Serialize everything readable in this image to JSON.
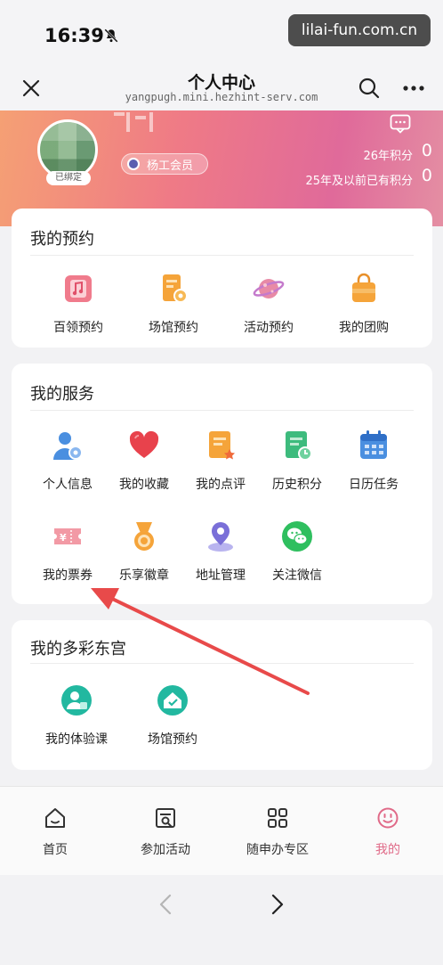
{
  "status": {
    "time": "16:39",
    "watermark": "lilai-fun.com.cn"
  },
  "nav": {
    "title": "个人中心",
    "subtitle": "yangpugh.mini.hezhint-serv.com"
  },
  "profile": {
    "bound_badge": "已绑定",
    "member_label": "杨工会员",
    "points_this_year_label": "26年积分",
    "points_this_year_value": "0",
    "points_prior_label": "25年及以前已有积分",
    "points_prior_value": "0"
  },
  "reservations": {
    "title": "我的预约",
    "items": [
      {
        "label": "百领预约",
        "icon": "music-note-icon"
      },
      {
        "label": "场馆预约",
        "icon": "venue-icon"
      },
      {
        "label": "活动预约",
        "icon": "planet-icon"
      },
      {
        "label": "我的团购",
        "icon": "shopping-bag-icon"
      }
    ]
  },
  "services": {
    "title": "我的服务",
    "items": [
      {
        "label": "个人信息",
        "icon": "user-icon"
      },
      {
        "label": "我的收藏",
        "icon": "heart-icon"
      },
      {
        "label": "我的点评",
        "icon": "review-icon"
      },
      {
        "label": "历史积分",
        "icon": "points-history-icon"
      },
      {
        "label": "日历任务",
        "icon": "calendar-icon"
      },
      {
        "label": "我的票券",
        "icon": "ticket-icon"
      },
      {
        "label": "乐享徽章",
        "icon": "medal-icon"
      },
      {
        "label": "地址管理",
        "icon": "location-pin-icon"
      },
      {
        "label": "关注微信",
        "icon": "wechat-icon"
      }
    ]
  },
  "colorful": {
    "title": "我的多彩东宫",
    "items": [
      {
        "label": "我的体验课",
        "icon": "class-icon"
      },
      {
        "label": "场馆预约",
        "icon": "home-venue-icon"
      }
    ]
  },
  "tabs": [
    {
      "label": "首页",
      "icon": "home-icon"
    },
    {
      "label": "参加活动",
      "icon": "activity-icon"
    },
    {
      "label": "随申办专区",
      "icon": "grid-icon"
    },
    {
      "label": "我的",
      "icon": "smile-icon"
    }
  ],
  "colors": {
    "accent": "#e06a88",
    "banner_start": "#f5a074",
    "banner_end": "#e06a9a",
    "arrow": "#e84a4a"
  }
}
